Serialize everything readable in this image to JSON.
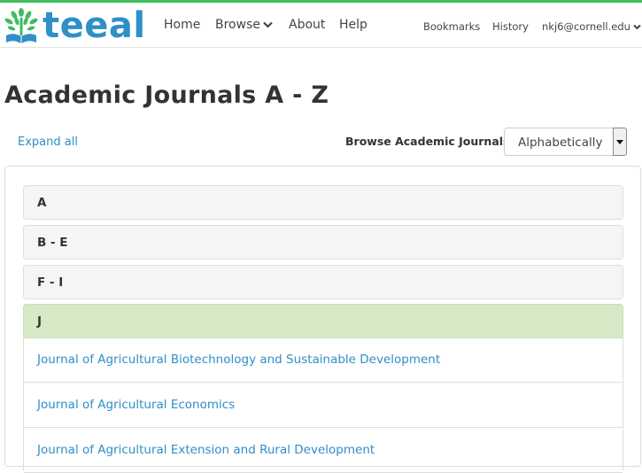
{
  "brand": {
    "logo_text": "teeal"
  },
  "nav": {
    "home": "Home",
    "browse": "Browse",
    "about": "About",
    "help": "Help",
    "bookmarks": "Bookmarks",
    "history": "History",
    "user": "nkj6@cornell.edu"
  },
  "page": {
    "title": "Academic Journals A - Z",
    "expand_all": "Expand all",
    "browse_label": "Browse Academic Journals",
    "browse_select_value": "Alphabetically"
  },
  "sections": [
    {
      "label": "A"
    },
    {
      "label": "B - E"
    },
    {
      "label": "F - I"
    },
    {
      "label": "J"
    }
  ],
  "journals": [
    "Journal of Agricultural Biotechnology and Sustainable Development",
    "Journal of Agricultural Economics",
    "Journal of Agricultural Extension and Rural Development"
  ],
  "colors": {
    "accent": "#2f8fc7",
    "top_bar": "#3dbd5d",
    "active_section": "#d6e9c6"
  }
}
